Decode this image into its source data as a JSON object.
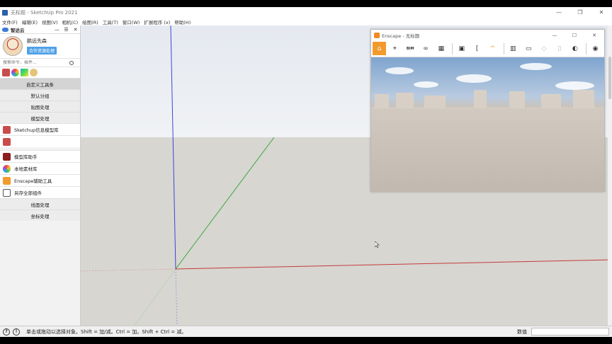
{
  "window": {
    "title": "无标题 - SketchUp Pro 2021",
    "controls": [
      "—",
      "❐",
      "✕"
    ]
  },
  "menubar": [
    "文件(F)",
    "编辑(E)",
    "视图(V)",
    "相机(C)",
    "绘图(R)",
    "工具(T)",
    "窗口(W)",
    "扩展程序 (x)",
    "帮助(H)"
  ],
  "panel": {
    "title": "智达云",
    "controls": [
      "—",
      "☰",
      "✕"
    ],
    "user_name": "鹏远先森",
    "user_badge": "合作资源处理",
    "search_placeholder": "搜索命令、插件...",
    "sections": {
      "custom_toolbar": "自定义工具条",
      "default_group": "默认分组",
      "texture": "贴图处理",
      "model": "模型处理",
      "lines": "线面处理",
      "coords": "坐标处理"
    },
    "tools": {
      "library": "Sketchup信息模型库",
      "model_helper": "模型库助手",
      "local_material": "本地素材库",
      "enscape_tools": "Enscape辅助工具",
      "save_components": "另存全部组件"
    }
  },
  "enscape": {
    "title": "Enscape - 无标题",
    "controls": [
      "—",
      "☐",
      "✕"
    ],
    "bim_label": "BIM"
  },
  "statusbar": {
    "message": "单击或拖动以选择对象。Shift = 加/减。Ctrl = 加。Shift + Ctrl = 减。",
    "measure_label": "数值",
    "measure_value": ""
  },
  "colors": {
    "axis_blue": "#3b46d6",
    "axis_green": "#3da83d",
    "axis_red": "#c53b3b",
    "enscape_accent": "#f39a2c",
    "badge": "#4ea1e8"
  }
}
